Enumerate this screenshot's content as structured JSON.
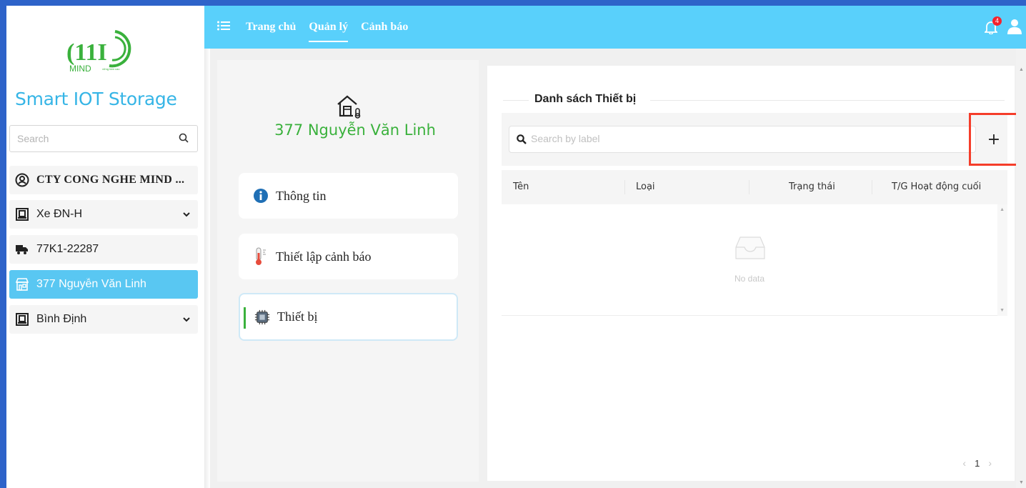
{
  "sidebar": {
    "logo_text": "MIND",
    "logo_tagline": "vững tầm cao",
    "brand": "Smart IOT Storage",
    "search_placeholder": "Search",
    "items": [
      {
        "label": "CTY CONG NGHE MIND ...",
        "icon": "user-circle-icon"
      },
      {
        "label": "Xe ĐN-H",
        "icon": "group-icon"
      },
      {
        "label": "77K1-22287",
        "icon": "truck-icon"
      },
      {
        "label": "377 Nguyễn Văn Linh",
        "icon": "store-icon"
      },
      {
        "label": "Bình Định",
        "icon": "group-icon"
      }
    ]
  },
  "topbar": {
    "nav": [
      "Trang chủ",
      "Quản lý",
      "Cảnh báo"
    ],
    "active_nav": "Quản lý",
    "notification_count": "4"
  },
  "site": {
    "title": "377 Nguyễn Văn Linh",
    "menu": [
      {
        "label": "Thông tin",
        "icon": "info-icon"
      },
      {
        "label": "Thiết lập cảnh báo",
        "icon": "thermometer-icon"
      },
      {
        "label": "Thiết bị",
        "icon": "chip-icon"
      }
    ]
  },
  "devices": {
    "title": "Danh sách Thiết bị",
    "search_placeholder": "Search by label",
    "add_label": "+",
    "columns": [
      "Tên",
      "Loại",
      "Trạng thái",
      "T/G Hoạt động cuối"
    ],
    "empty_text": "No data",
    "page": "1"
  },
  "colors": {
    "topbar": "#59d0fb",
    "active_item": "#59c7f2",
    "brand": "#36b5e6",
    "accent_green": "#3ab13c",
    "highlight_red": "#f53d2a"
  }
}
